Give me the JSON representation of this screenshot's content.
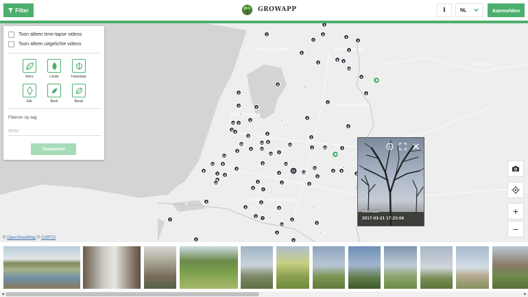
{
  "header": {
    "filter_label": "Filter",
    "logo_text": "GROWAPP",
    "info_label": "i",
    "language": "NL",
    "login_label": "Aanmelden"
  },
  "filters": {
    "timelapse_label": "Toon alleen time-lapse videos",
    "featured_label": "Toon alleen uitgelichte videos",
    "trees": [
      {
        "label": "Kers",
        "icon": "cherry-leaf-icon"
      },
      {
        "label": "Linde",
        "icon": "linden-leaf-icon"
      },
      {
        "label": "Hazelaar",
        "icon": "hazel-leaf-icon"
      },
      {
        "label": "Eik",
        "icon": "oak-leaf-icon"
      },
      {
        "label": "Berk",
        "icon": "birch-leaf-icon"
      },
      {
        "label": "Beuk",
        "icon": "beech-leaf-icon"
      }
    ],
    "tag_title": "Filteren op tag",
    "tag_placeholder": "#tree",
    "apply_label": "Toepassen"
  },
  "map": {
    "labels": [
      {
        "text": "Waddenzee"
      },
      {
        "text": "Groningen"
      },
      {
        "text": "Bremen"
      },
      {
        "text": "Amsterdam"
      },
      {
        "text": "Hardenberg"
      },
      {
        "text": "'s-Hertogenbosch"
      }
    ],
    "markers": [
      "2",
      "4",
      "3",
      "4",
      "5",
      "3",
      "2",
      "4",
      "3",
      "10",
      "2",
      "4",
      "3",
      "6",
      "3",
      "2",
      "4",
      "3",
      "2",
      "2",
      "14",
      "4",
      "3",
      "2",
      "3",
      "3",
      "5",
      "2",
      "10",
      "12",
      "8",
      "14",
      "6",
      "11",
      "3",
      "3",
      "11",
      "12",
      "13",
      "11",
      "8",
      "4",
      "7",
      "2",
      "3",
      "8",
      "3",
      "3",
      "3",
      "9",
      "3",
      "11",
      "6",
      "4",
      "2",
      "22",
      "13",
      "5",
      "4",
      "2",
      "7",
      "12",
      "7",
      "2",
      "4",
      "3",
      "2",
      "7",
      "4",
      "3",
      "2",
      "5",
      "3",
      "4",
      "13",
      "2",
      "3",
      "3",
      "24"
    ],
    "attribution_prefix": "©",
    "attribution_osm": "OpenStreetMap",
    "attribution_sep": "©",
    "attribution_carto": "CARTO"
  },
  "popup": {
    "location": "eikenlaan",
    "timestamp": "2017-03-21 17:23:06"
  },
  "controls": {
    "zoom_in": "+",
    "zoom_out": "−"
  },
  "colors": {
    "brand_green": "#4caf6e",
    "marker": "#2e3640",
    "map_background": "#e7e7e7"
  }
}
